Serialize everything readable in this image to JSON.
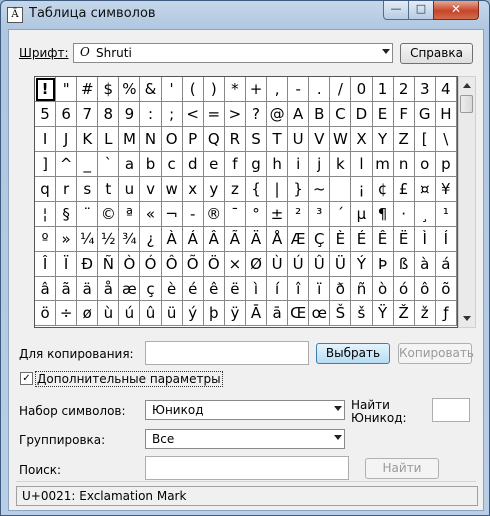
{
  "window": {
    "title": "Таблица символов",
    "app_icon": "Ä"
  },
  "caption": {
    "minimize": "—",
    "maximize": "□",
    "close": "✕"
  },
  "font_row": {
    "label": "Шрифт:",
    "font_glyph": "O",
    "font_name": "Shruti",
    "help_button": "Справка"
  },
  "grid": {
    "chars": [
      "!",
      "\"",
      "#",
      "$",
      "%",
      "&",
      "'",
      "(",
      ")",
      "*",
      "+",
      ",",
      "-",
      ".",
      "/",
      "0",
      "1",
      "2",
      "3",
      "4",
      "5",
      "6",
      "7",
      "8",
      "9",
      ":",
      ";",
      "<",
      "=",
      ">",
      "?",
      "@",
      "A",
      "B",
      "C",
      "D",
      "E",
      "F",
      "G",
      "H",
      "I",
      "J",
      "K",
      "L",
      "M",
      "N",
      "O",
      "P",
      "Q",
      "R",
      "S",
      "T",
      "U",
      "V",
      "W",
      "X",
      "Y",
      "Z",
      "[",
      "\\",
      "]",
      "^",
      "_",
      "`",
      "a",
      "b",
      "c",
      "d",
      "e",
      "f",
      "g",
      "h",
      "i",
      "j",
      "k",
      "l",
      "m",
      "n",
      "o",
      "p",
      "q",
      "r",
      "s",
      "t",
      "u",
      "v",
      "w",
      "x",
      "y",
      "z",
      "{",
      "|",
      "}",
      "~",
      " ",
      "¡",
      "¢",
      "£",
      "¤",
      "¥",
      "¦",
      "§",
      "¨",
      "©",
      "ª",
      "«",
      "¬",
      "-",
      "®",
      "¯",
      "°",
      "±",
      "²",
      "³",
      "´",
      "µ",
      "¶",
      "·",
      "¸",
      "¹",
      "º",
      "»",
      "¼",
      "½",
      "¾",
      "¿",
      "À",
      "Á",
      "Â",
      "Ã",
      "Ä",
      "Å",
      "Æ",
      "Ç",
      "È",
      "É",
      "Ê",
      "Ë",
      "Ì",
      "Í",
      "Î",
      "Ï",
      "Ð",
      "Ñ",
      "Ò",
      "Ó",
      "Ô",
      "Õ",
      "Ö",
      "×",
      "Ø",
      "Ù",
      "Ú",
      "Û",
      "Ü",
      "Ý",
      "Þ",
      "ß",
      "à",
      "á",
      "â",
      "ã",
      "ä",
      "å",
      "æ",
      "ç",
      "è",
      "é",
      "ê",
      "ë",
      "ì",
      "í",
      "î",
      "ï",
      "ð",
      "ñ",
      "ò",
      "ó",
      "ô",
      "õ",
      "ö",
      "÷",
      "ø",
      "ù",
      "ú",
      "û",
      "ü",
      "ý",
      "þ",
      "ÿ",
      "Ā",
      "ā",
      "Œ",
      "œ",
      "Š",
      "š",
      "Ÿ",
      "Ž",
      "ž",
      "ƒ"
    ],
    "selected_index": 0
  },
  "copy_row": {
    "label": "Для копирования:",
    "value": "",
    "select_button": "Выбрать",
    "copy_button": "Копировать"
  },
  "advanced": {
    "label": "Дополнительные параметры",
    "checked": "✓"
  },
  "charset": {
    "label": "Набор символов:",
    "value": "Юникод",
    "goto_label_1": "Найти",
    "goto_label_2": "Юникод:",
    "goto_value": ""
  },
  "grouping": {
    "label": "Группировка:",
    "value": "Все"
  },
  "search": {
    "label": "Поиск:",
    "value": "",
    "button": "Найти"
  },
  "status": {
    "text": "U+0021: Exclamation Mark"
  }
}
